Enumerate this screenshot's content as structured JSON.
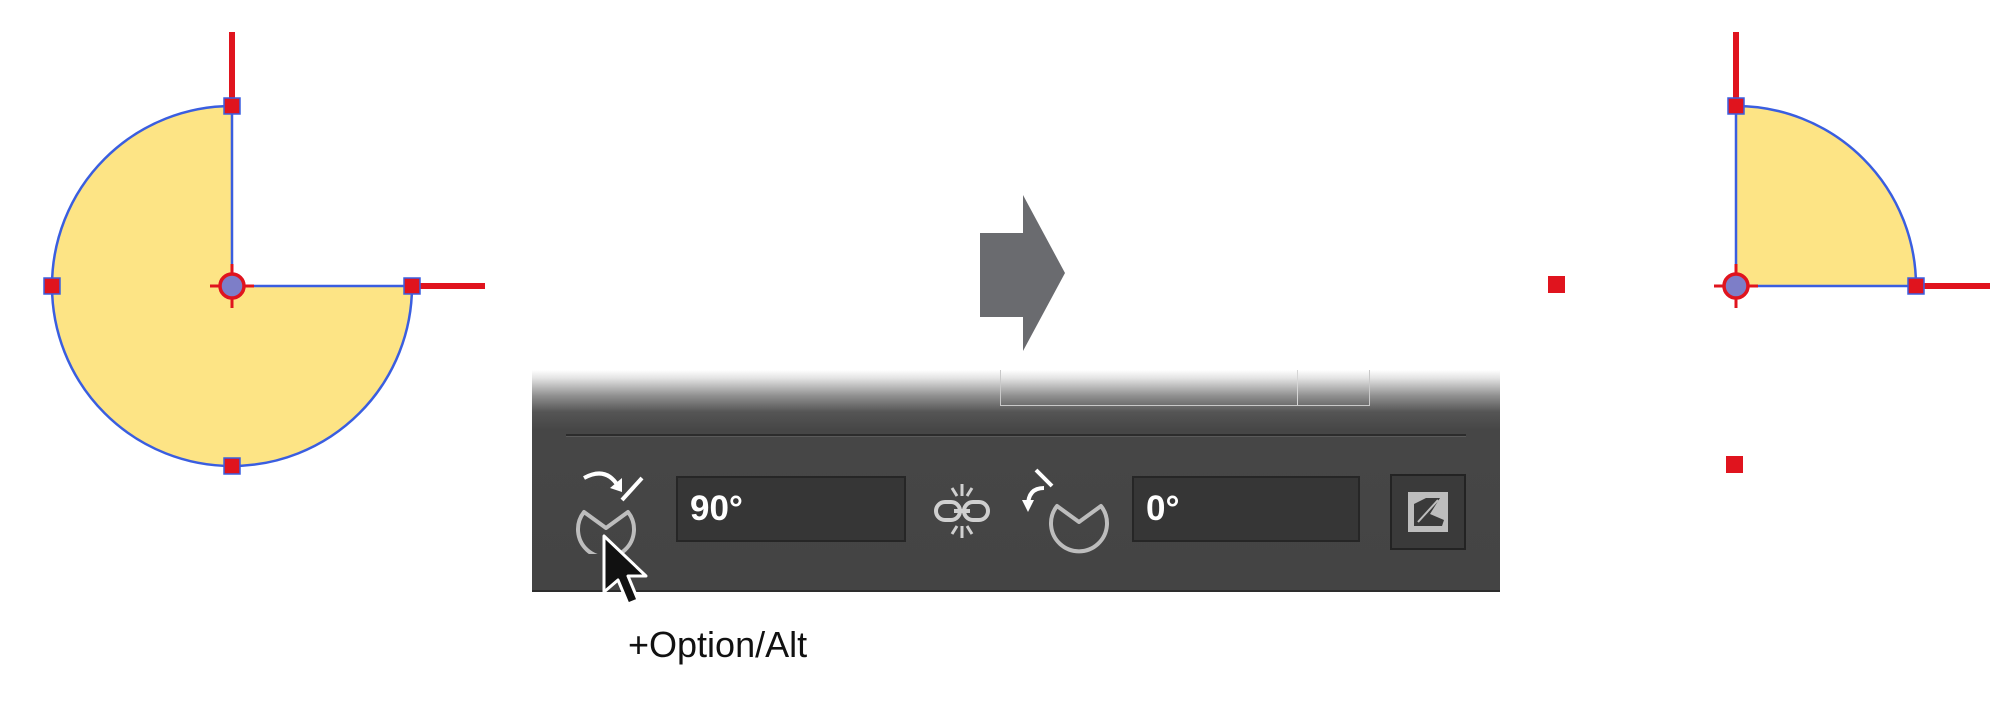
{
  "colors": {
    "pie_fill": "#fde485",
    "pie_stroke": "#3a5ee0",
    "anchor_marker": "#e0141e",
    "panel_background": "#444444",
    "field_background": "#363636",
    "arrow_gray": "#6a6b6f"
  },
  "canvas": {
    "before_shape": "pie-shape-three-quarter",
    "after_shape": "pie-shape-quarter",
    "arrow_icon": "right-arrow-icon"
  },
  "panel": {
    "start_angle_icon": "pie-start-angle-icon",
    "start_angle_value": "90°",
    "link_icon": "link-angles-icon",
    "end_angle_icon": "pie-end-angle-icon",
    "end_angle_value": "0°",
    "invert_icon": "invert-pie-icon"
  },
  "cursor": {
    "icon": "mouse-pointer-icon",
    "modifier_label": "+Option/Alt"
  }
}
